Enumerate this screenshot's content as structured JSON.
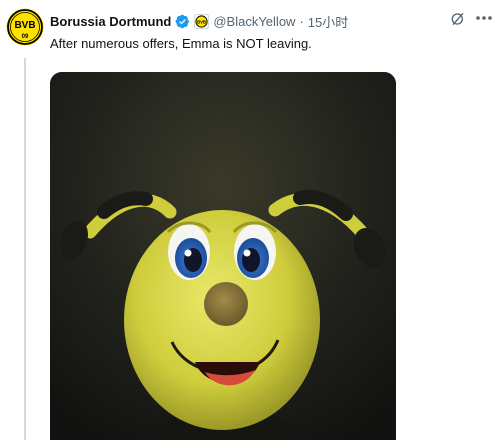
{
  "tweet": {
    "author_name": "Borussia Dortmund",
    "handle": "@BlackYellow",
    "separator": "·",
    "time": "15小时",
    "text": "After numerous offers, Emma is NOT leaving.",
    "avatar_text": "BVB",
    "avatar_year": "09",
    "media_description": "photo"
  },
  "icons": {
    "verified": "verified-badge-icon",
    "affiliate": "bvb-affiliate-badge-icon",
    "grok": "grok-icon",
    "more": "more-options-icon"
  },
  "colors": {
    "brand_yellow": "#fde100",
    "verified_blue": "#1d9bf0",
    "text_primary": "#0f1419",
    "text_secondary": "#536471"
  }
}
